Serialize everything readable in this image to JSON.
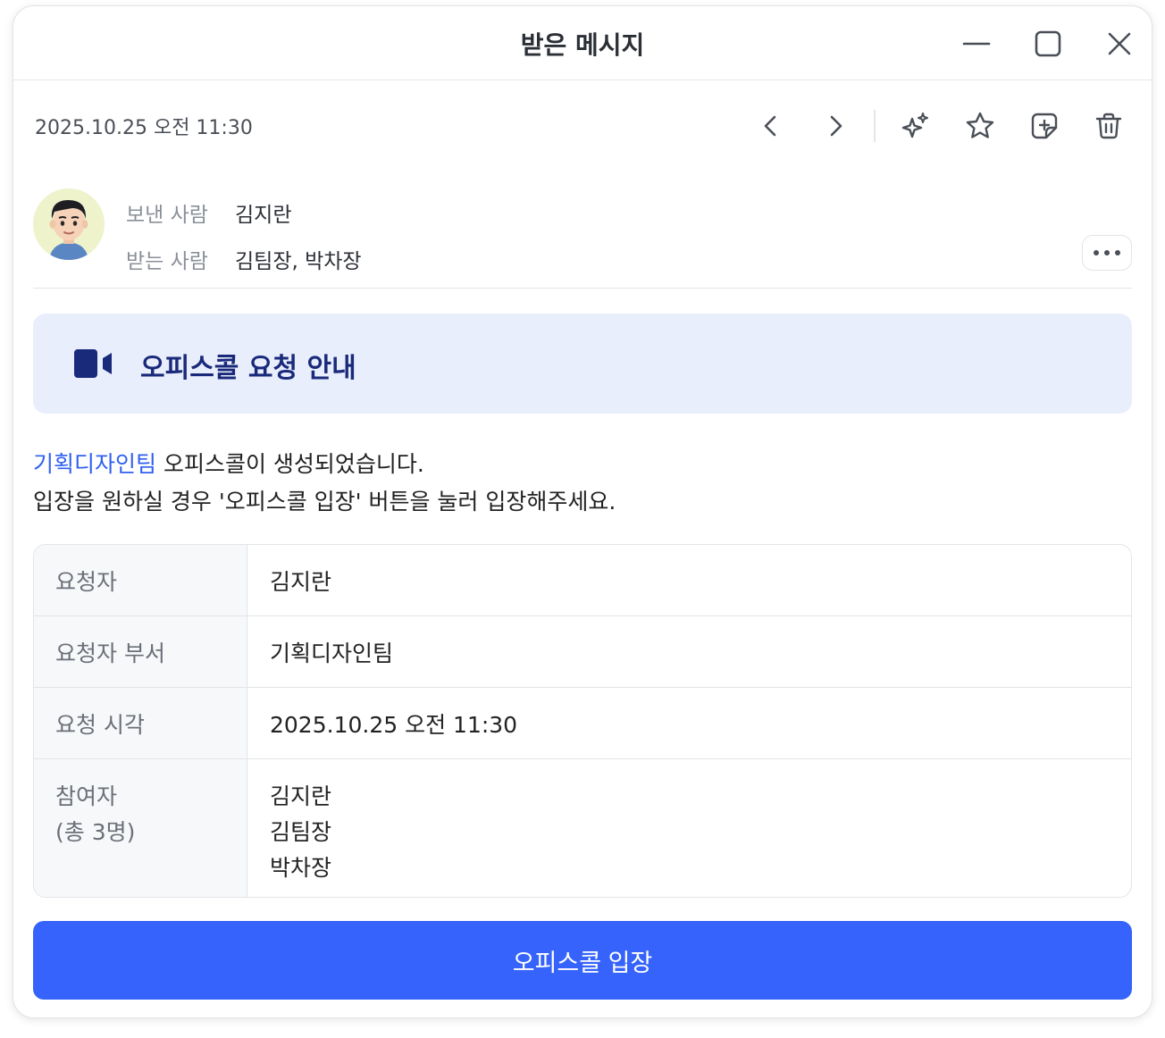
{
  "window": {
    "title": "받은 메시지"
  },
  "toolbar": {
    "datetime": "2025.10.25 오전 11:30",
    "icons": [
      "chevron-left-icon",
      "chevron-right-icon",
      "sparkle-icon",
      "star-icon",
      "sticker-add-icon",
      "trash-icon"
    ]
  },
  "message": {
    "sender_label": "보낸 사람",
    "sender_value": "김지란",
    "recipient_label": "받는 사람",
    "recipient_value": "김팀장, 박차장"
  },
  "notice": {
    "title": "오피스콜 요청 안내",
    "icon": "video-camera-icon"
  },
  "body": {
    "team_link": "기획디자인팀",
    "line1_rest": " 오피스콜이 생성되었습니다.",
    "line2": "입장을 원하실 경우 '오피스콜 입장' 버튼을 눌러 입장해주세요."
  },
  "details": {
    "rows": [
      {
        "label": "요청자",
        "value": "김지란"
      },
      {
        "label": "요청자 부서",
        "value": "기획디자인팀"
      },
      {
        "label": "요청 시각",
        "value": "2025.10.25 오전 11:30"
      }
    ],
    "participants": {
      "label_line1": "참여자",
      "label_line2": "(총 3명)",
      "names": [
        "김지란",
        "김팀장",
        "박차장"
      ]
    }
  },
  "action": {
    "enter_label": "오피스콜 입장"
  },
  "colors": {
    "accent": "#3563fb",
    "link": "#3060f0",
    "notice_bg": "#e9eefc",
    "notice_text": "#1a2a7a"
  }
}
